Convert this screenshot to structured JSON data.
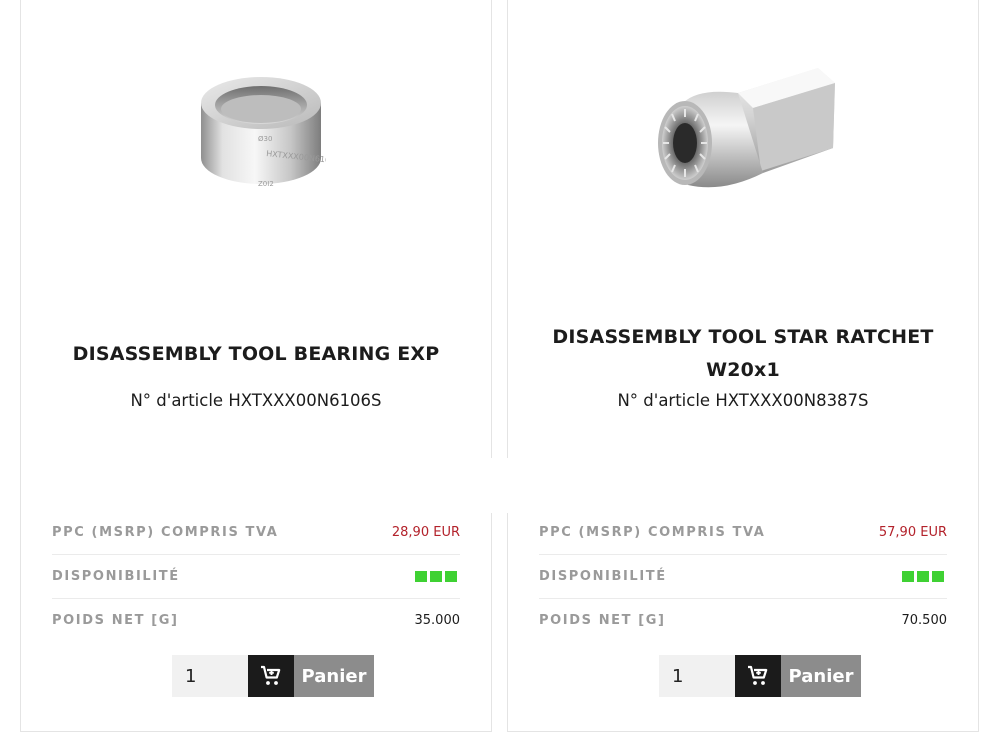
{
  "products": [
    {
      "title": "DISASSEMBLY TOOL BEARING EXP",
      "article": "N° d'article HXTXXX00N6106S",
      "image_icon": "bearing-ring-tool-image",
      "price_label": "PPC (MSRP) COMPRIS TVA",
      "price": "28,90 EUR",
      "availability_label": "DISPONIBILITÉ",
      "availability_level": 3,
      "weight_label": "POIDS NET [G]",
      "weight": "35.000",
      "quantity": "1",
      "cart_label": "Panier"
    },
    {
      "title": "DISASSEMBLY TOOL STAR RATCHET W20x1",
      "article": "N° d'article HXTXXX00N8387S",
      "image_icon": "star-ratchet-tool-image",
      "price_label": "PPC (MSRP) COMPRIS TVA",
      "price": "57,90 EUR",
      "availability_label": "DISPONIBILITÉ",
      "availability_level": 3,
      "weight_label": "POIDS NET [G]",
      "weight": "70.500",
      "quantity": "1",
      "cart_label": "Panier"
    }
  ],
  "colors": {
    "price": "#b3222b",
    "availability": "#3fd133",
    "cart_icon_bg": "#1b1b1b",
    "cart_button_bg": "#8c8c8c"
  }
}
